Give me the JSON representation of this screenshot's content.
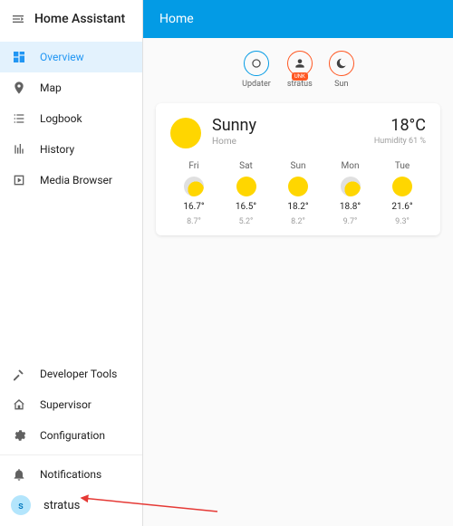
{
  "brand": "Home Assistant",
  "header": {
    "title": "Home"
  },
  "nav": [
    {
      "label": "Overview"
    },
    {
      "label": "Map"
    },
    {
      "label": "Logbook"
    },
    {
      "label": "History"
    },
    {
      "label": "Media Browser"
    }
  ],
  "tools": [
    {
      "label": "Developer Tools"
    },
    {
      "label": "Supervisor"
    },
    {
      "label": "Configuration"
    }
  ],
  "notifications_label": "Notifications",
  "user": {
    "name": "stratus",
    "initial": "s"
  },
  "badges": [
    {
      "label": "Updater",
      "color": "blue",
      "icon": "circle"
    },
    {
      "label": "stratus",
      "color": "orange",
      "icon": "person",
      "chip": "UNK"
    },
    {
      "label": "Sun",
      "color": "orange",
      "icon": "moon"
    }
  ],
  "weather": {
    "condition": "Sunny",
    "location": "Home",
    "temp": "18°C",
    "humidity": "Humidity 61 %",
    "forecast": [
      {
        "day": "Fri",
        "hi": "16.7°",
        "lo": "8.7°",
        "icon": "cloud"
      },
      {
        "day": "Sat",
        "hi": "16.5°",
        "lo": "5.2°",
        "icon": "sun"
      },
      {
        "day": "Sun",
        "hi": "18.2°",
        "lo": "8.2°",
        "icon": "sun"
      },
      {
        "day": "Mon",
        "hi": "18.8°",
        "lo": "9.7°",
        "icon": "cloud"
      },
      {
        "day": "Tue",
        "hi": "21.6°",
        "lo": "9.3°",
        "icon": "sun"
      }
    ]
  }
}
